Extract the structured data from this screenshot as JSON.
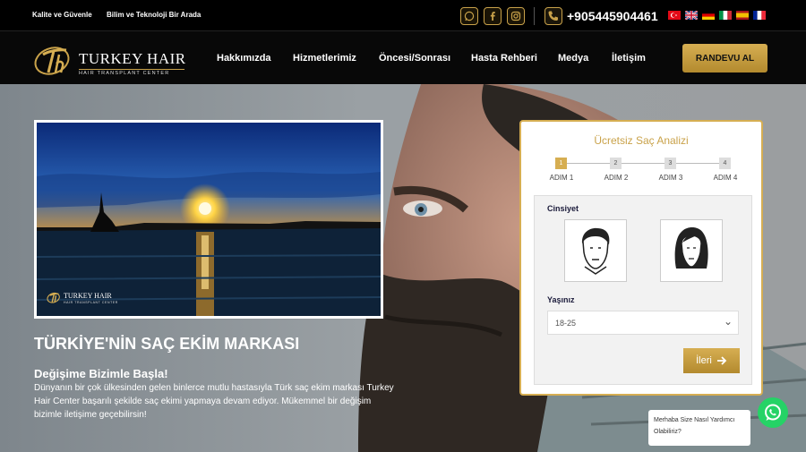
{
  "topbar": {
    "tag1": "Kalite ve Güvenle",
    "tag2": "Bilim ve Teknoloji Bir Arada",
    "social": [
      "whatsapp-icon",
      "facebook-icon",
      "instagram-icon"
    ],
    "phone": "+905445904461",
    "languages": [
      "Türkçe",
      "English",
      "Deutsch",
      "Italiano",
      "Español",
      "Français"
    ]
  },
  "nav": {
    "logo_text": "TURKEY HAIR",
    "logo_sub": "HAIR TRANSPLANT CENTER",
    "items": [
      "Hakkımızda",
      "Hizmetlerimiz",
      "Öncesi/Sonrası",
      "Hasta Rehberi",
      "Medya",
      "İletişim"
    ],
    "cta": "RANDEVU AL"
  },
  "hero": {
    "photo_logo": "TURKEY HAIR",
    "photo_logo_sub": "HAIR TRANSPLANT CENTER",
    "title": "TÜRKİYE'NİN SAÇ EKİM MARKASI",
    "subtitle": "Değişime Bizimle Başla!",
    "description": "Dünyanın bir çok ülkesinden gelen binlerce mutlu hastasıyla Türk saç ekim markası Turkey Hair Center başarılı şekilde saç ekimi yapmaya devam ediyor. Mükemmel bir değişim bizimle iletişime geçebilirsin!"
  },
  "form": {
    "title": "Ücretsiz Saç Analizi",
    "steps": [
      {
        "num": "1",
        "label": "ADIM 1",
        "active": true
      },
      {
        "num": "2",
        "label": "ADIM 2",
        "active": false
      },
      {
        "num": "3",
        "label": "ADIM 3",
        "active": false
      },
      {
        "num": "4",
        "label": "ADIM 4",
        "active": false
      }
    ],
    "gender_label": "Cinsiyet",
    "age_label": "Yaşınız",
    "age_value": "18-25",
    "next_label": "İleri"
  },
  "chat": {
    "message": "Merhaba Size Nasıl Yardımcı Olabiliriz?"
  },
  "colors": {
    "gold": "#d6ae52",
    "dark": "#080808"
  }
}
